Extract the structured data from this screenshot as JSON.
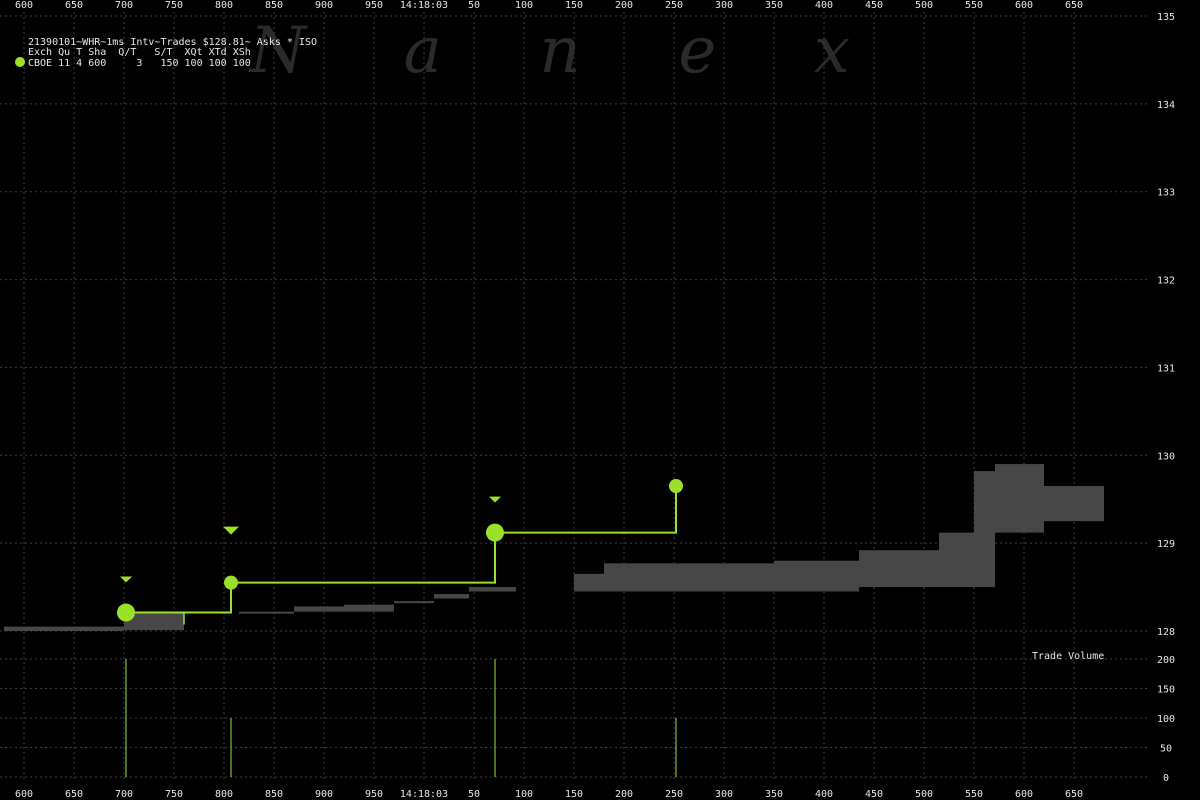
{
  "header": {
    "title": "21390101~WHR~1ms Intv~Trades $128.81~ Asks * ISO",
    "columns": "Exch Qu T Sha  Q/T   S/T  XQt XTd XSh",
    "row": "CBOE 11 4 600     3   150 100 100 100"
  },
  "watermark": [
    "N",
    "a",
    "n",
    "e",
    "x"
  ],
  "volume_label": "Trade Volume",
  "colors": {
    "trade": "#9be02b",
    "ask": "#474747",
    "grid": "#3c3c3c",
    "text": "#e6e6e6",
    "background": "#000000"
  },
  "chart_data": {
    "type": "step-line",
    "time_label": "14:18:03",
    "x_ticks": [
      "600",
      "650",
      "700",
      "750",
      "800",
      "850",
      "900",
      "950",
      "14:18:03",
      "50",
      "100",
      "150",
      "200",
      "250",
      "300",
      "350",
      "400",
      "450",
      "500",
      "550",
      "600",
      "650"
    ],
    "x_range_ms": [
      580,
      1680
    ],
    "price_axis": {
      "ticks": [
        "135",
        "134",
        "133",
        "132",
        "131",
        "130",
        "129",
        "128"
      ],
      "ylim": [
        128,
        135
      ]
    },
    "volume_axis": {
      "ticks": [
        "200",
        "150",
        "100",
        "50",
        "0"
      ],
      "ylim": [
        0,
        200
      ]
    },
    "trades": [
      {
        "ms": 702,
        "price": 128.21,
        "volume": 200,
        "size": "large",
        "marker": "triangle"
      },
      {
        "ms": 807,
        "price": 128.55,
        "volume": 100,
        "size": "small",
        "marker": "triangle"
      },
      {
        "ms": 1071,
        "price": 129.12,
        "volume": 200,
        "size": "large",
        "marker": "triangle"
      },
      {
        "ms": 1252,
        "price": 129.65,
        "volume": 100,
        "size": "small",
        "marker": "none"
      }
    ],
    "asks": [
      {
        "ms0": 580,
        "ms1": 700,
        "lo": 128.0,
        "hi": 128.05
      },
      {
        "ms0": 700,
        "ms1": 760,
        "lo": 128.01,
        "hi": 128.2
      },
      {
        "ms0": 815,
        "ms1": 870,
        "lo": 128.2,
        "hi": 128.22
      },
      {
        "ms0": 870,
        "ms1": 920,
        "lo": 128.22,
        "hi": 128.28
      },
      {
        "ms0": 920,
        "ms1": 970,
        "lo": 128.22,
        "hi": 128.3
      },
      {
        "ms0": 970,
        "ms1": 1010,
        "lo": 128.32,
        "hi": 128.34
      },
      {
        "ms0": 1010,
        "ms1": 1045,
        "lo": 128.37,
        "hi": 128.42
      },
      {
        "ms0": 1045,
        "ms1": 1092,
        "lo": 128.45,
        "hi": 128.5
      },
      {
        "ms0": 1150,
        "ms1": 1180,
        "lo": 128.45,
        "hi": 128.65
      },
      {
        "ms0": 1180,
        "ms1": 1350,
        "lo": 128.45,
        "hi": 128.77
      },
      {
        "ms0": 1350,
        "ms1": 1435,
        "lo": 128.45,
        "hi": 128.8
      },
      {
        "ms0": 1435,
        "ms1": 1515,
        "lo": 128.5,
        "hi": 128.92
      },
      {
        "ms0": 1515,
        "ms1": 1550,
        "lo": 128.5,
        "hi": 129.12
      },
      {
        "ms0": 1550,
        "ms1": 1571,
        "lo": 128.5,
        "hi": 129.82
      },
      {
        "ms0": 1571,
        "ms1": 1620,
        "lo": 129.12,
        "hi": 129.9
      },
      {
        "ms0": 1620,
        "ms1": 1680,
        "lo": 129.25,
        "hi": 129.65
      }
    ]
  }
}
